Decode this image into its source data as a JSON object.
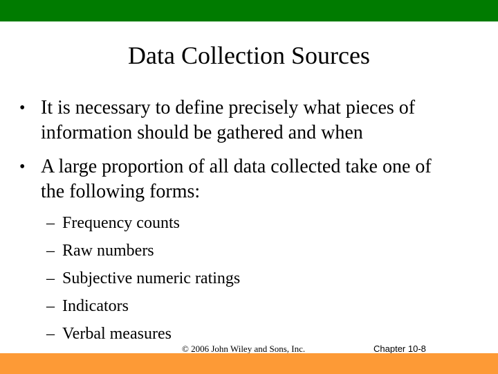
{
  "slide": {
    "title": "Data Collection Sources",
    "bullets": [
      {
        "symbol": "•",
        "lines": [
          "It is necessary to define precisely what pieces of",
          "information should be gathered and when"
        ]
      },
      {
        "symbol": "•",
        "lines": [
          "A large proportion of all data collected take one of",
          "the following forms:"
        ]
      }
    ],
    "sub_bullets": [
      {
        "symbol": "–",
        "text": "Frequency counts"
      },
      {
        "symbol": "–",
        "text": "Raw numbers"
      },
      {
        "symbol": "–",
        "text": "Subjective numeric ratings"
      },
      {
        "symbol": "–",
        "text": "Indicators"
      },
      {
        "symbol": "–",
        "text": "Verbal measures"
      }
    ],
    "footer": {
      "copyright": "© 2006 John Wiley and Sons, Inc.",
      "chapter": "Chapter  10-8"
    },
    "colors": {
      "top_bar": "#007b00",
      "bottom_bar": "#fd9a36"
    }
  }
}
